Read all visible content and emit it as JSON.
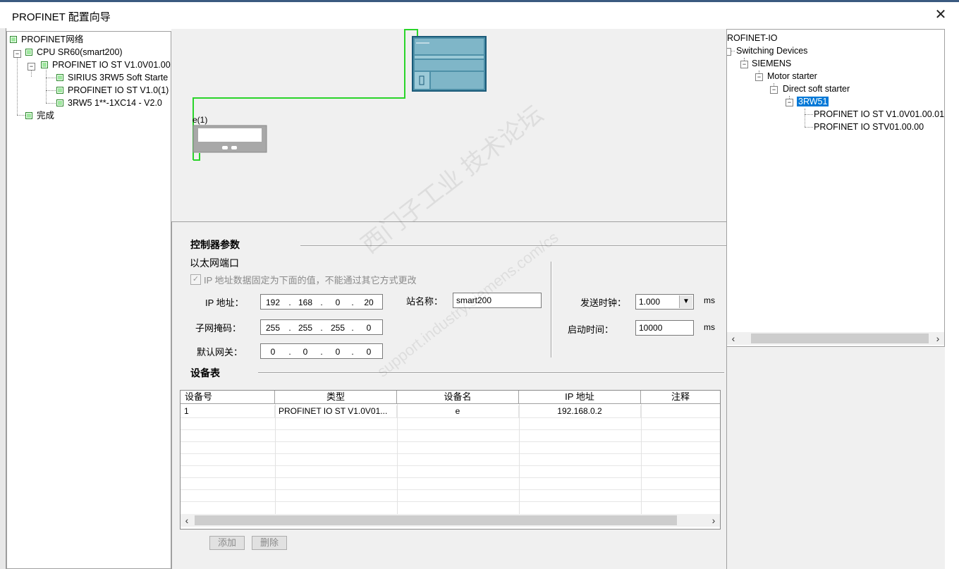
{
  "window": {
    "title": "PROFINET 配置向导"
  },
  "left_tree": {
    "items": [
      {
        "label": "PROFINET网络"
      },
      {
        "label": "CPU SR60(smart200)"
      },
      {
        "label": "PROFINET IO ST V1.0V01.00"
      },
      {
        "label": "SIRIUS 3RW5 Soft Starte"
      },
      {
        "label": "PROFINET IO ST V1.0(1)"
      },
      {
        "label": "3RW5 1**-1XC14 - V2.0"
      },
      {
        "label": "完成"
      }
    ]
  },
  "network_view": {
    "device_label": "e(1)"
  },
  "controller_params": {
    "section_title": "控制器参数",
    "ethernet_port_label": "以太网端口",
    "fixed_ip_checkbox_label": "IP 地址数据固定为下面的值，不能通过其它方式更改",
    "fixed_ip_checked": true,
    "ip_label": "IP 地址：",
    "ip": [
      "192",
      "168",
      "0",
      "20"
    ],
    "subnet_label": "子网掩码：",
    "subnet": [
      "255",
      "255",
      "255",
      "0"
    ],
    "gateway_label": "默认网关：",
    "gateway": [
      "0",
      "0",
      "0",
      "0"
    ],
    "station_name_label": "站名称：",
    "station_name": "smart200",
    "send_clock_label": "发送时钟：",
    "send_clock_value": "1.000",
    "send_clock_unit": "ms",
    "startup_time_label": "启动时间：",
    "startup_time_value": "10000",
    "startup_time_unit": "ms"
  },
  "device_table": {
    "section_title": "设备表",
    "columns": [
      "设备号",
      "类型",
      "设备名",
      "IP 地址",
      "注释"
    ],
    "rows": [
      {
        "id": "1",
        "type": "PROFINET IO ST V1.0V01...",
        "name": "e",
        "ip": "192.168.0.2",
        "comment": ""
      }
    ],
    "add_button": "添加",
    "delete_button": "删除"
  },
  "right_tree": {
    "items": [
      {
        "label": "ROFINET-IO"
      },
      {
        "label": "Switching Devices"
      },
      {
        "label": "SIEMENS"
      },
      {
        "label": "Motor starter"
      },
      {
        "label": "Direct soft starter"
      },
      {
        "label": "3RW51"
      },
      {
        "label": "PROFINET IO ST V1.0V01.00.01"
      },
      {
        "label": "PROFINET IO STV01.00.00"
      }
    ]
  },
  "watermark": {
    "line1": "西门子工业  技术论坛",
    "line2": "support.industry.siemens.com/cs"
  }
}
